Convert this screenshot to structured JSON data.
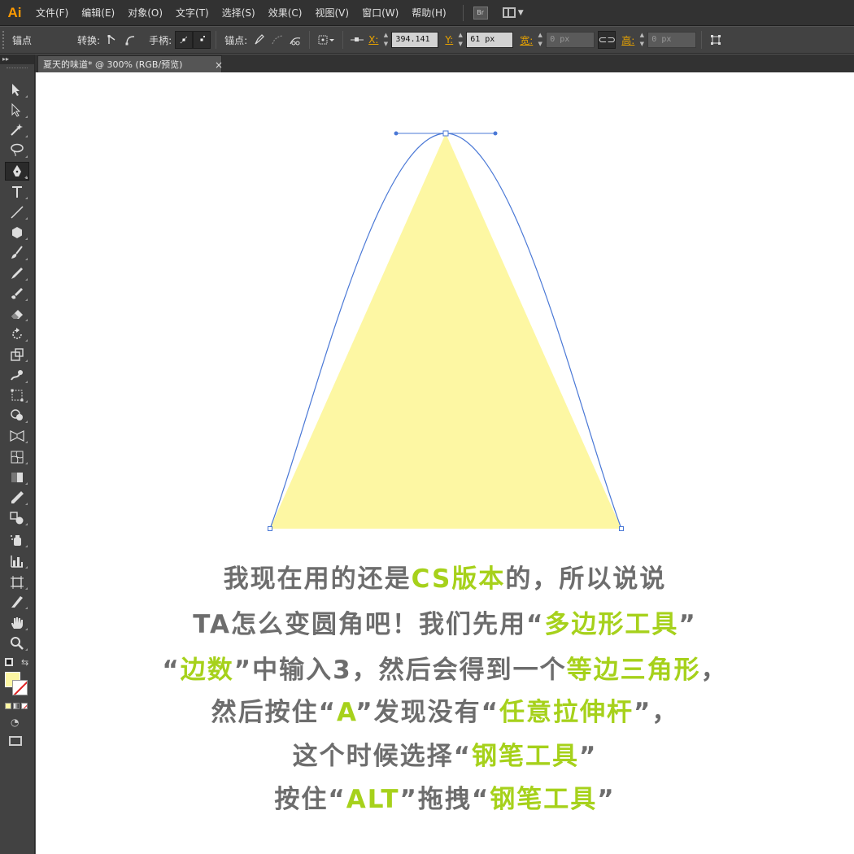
{
  "app": {
    "logo": "Ai",
    "menus": [
      "文件(F)",
      "编辑(E)",
      "对象(O)",
      "文字(T)",
      "选择(S)",
      "效果(C)",
      "视图(V)",
      "窗口(W)",
      "帮助(H)"
    ],
    "bridge_label": "Br"
  },
  "controlbar": {
    "anchor_label": "锚点",
    "convert_label": "转换:",
    "handles_label": "手柄:",
    "anchors_label": "锚点:",
    "x_label": "X:",
    "x_value": "394.141",
    "y_label": "Y:",
    "y_value": "61 px",
    "w_label": "宽:",
    "w_value": "0 px",
    "h_label": "高:",
    "h_value": "0 px"
  },
  "tab": {
    "title": "夏天的味道* @ 300% (RGB/预览)",
    "close": "×"
  },
  "tools": [
    {
      "name": "selection-tool",
      "icon": "arrow"
    },
    {
      "name": "direct-selection-tool",
      "icon": "arrow-hollow"
    },
    {
      "name": "magic-wand-tool",
      "icon": "wand"
    },
    {
      "name": "lasso-tool",
      "icon": "lasso"
    },
    {
      "name": "pen-tool",
      "icon": "pen"
    },
    {
      "name": "type-tool",
      "icon": "T"
    },
    {
      "name": "line-tool",
      "icon": "line"
    },
    {
      "name": "polygon-tool",
      "icon": "hexagon"
    },
    {
      "name": "paintbrush-tool",
      "icon": "brush"
    },
    {
      "name": "pencil-tool",
      "icon": "pencil"
    },
    {
      "name": "blob-brush-tool",
      "icon": "blob"
    },
    {
      "name": "eraser-tool",
      "icon": "eraser"
    },
    {
      "name": "rotate-tool",
      "icon": "rotate"
    },
    {
      "name": "scale-tool",
      "icon": "scale"
    },
    {
      "name": "warp-tool",
      "icon": "warp"
    },
    {
      "name": "free-transform-tool",
      "icon": "transform"
    },
    {
      "name": "shape-builder-tool",
      "icon": "shape-builder"
    },
    {
      "name": "perspective-grid-tool",
      "icon": "perspective"
    },
    {
      "name": "mesh-tool",
      "icon": "mesh"
    },
    {
      "name": "gradient-tool",
      "icon": "gradient"
    },
    {
      "name": "eyedropper-tool",
      "icon": "eyedropper"
    },
    {
      "name": "blend-tool",
      "icon": "blend"
    },
    {
      "name": "symbol-sprayer-tool",
      "icon": "sprayer"
    },
    {
      "name": "column-graph-tool",
      "icon": "graph"
    },
    {
      "name": "artboard-tool",
      "icon": "artboard"
    },
    {
      "name": "slice-tool",
      "icon": "slice"
    },
    {
      "name": "hand-tool",
      "icon": "hand"
    },
    {
      "name": "zoom-tool",
      "icon": "zoom"
    }
  ],
  "swatches": {
    "fill_color": "#fdf7a3",
    "stroke_color": "none"
  },
  "canvas": {
    "triangle_fill": "#fdf7a3",
    "path_color": "#4a78d6"
  },
  "tutorial": {
    "line1": [
      {
        "t": "我现在用的还是",
        "hl": false
      },
      {
        "t": "CS版本",
        "hl": true
      },
      {
        "t": "的，所以说说",
        "hl": false
      }
    ],
    "line2": [
      {
        "t": "TA怎么变圆角吧！我们先用“",
        "hl": false
      },
      {
        "t": "多边形工具",
        "hl": true
      },
      {
        "t": "”",
        "hl": false
      }
    ],
    "line3": [
      {
        "t": "“",
        "hl": false
      },
      {
        "t": "边数",
        "hl": true
      },
      {
        "t": "”中输入3，然后会得到一个",
        "hl": false
      },
      {
        "t": "等边三角形",
        "hl": true
      },
      {
        "t": "，",
        "hl": false
      }
    ],
    "line4": [
      {
        "t": "然后按住“",
        "hl": false
      },
      {
        "t": "A",
        "hl": true
      },
      {
        "t": "”发现没有“",
        "hl": false
      },
      {
        "t": "任意拉伸杆",
        "hl": true
      },
      {
        "t": "”，",
        "hl": false
      }
    ],
    "line5": [
      {
        "t": "这个时候选择“",
        "hl": false
      },
      {
        "t": "钢笔工具",
        "hl": true
      },
      {
        "t": "”",
        "hl": false
      }
    ],
    "line6": [
      {
        "t": "按住“",
        "hl": false
      },
      {
        "t": "ALT",
        "hl": true
      },
      {
        "t": "”拖拽“",
        "hl": false
      },
      {
        "t": "钢笔工具",
        "hl": true
      },
      {
        "t": "”",
        "hl": false
      }
    ]
  }
}
